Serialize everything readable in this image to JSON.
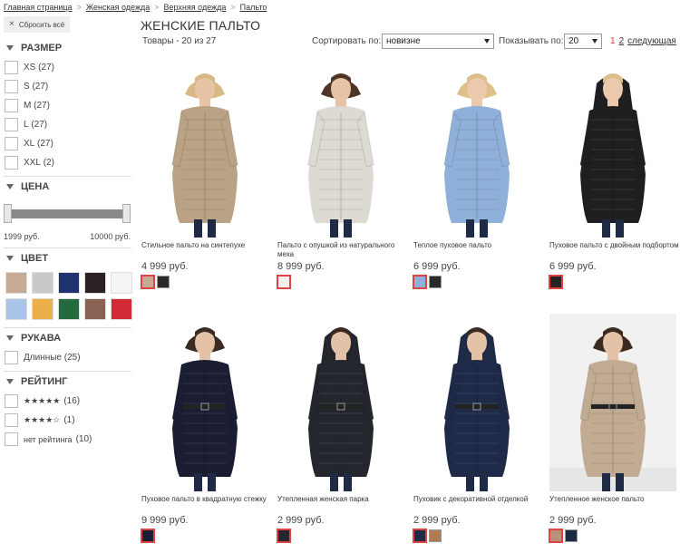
{
  "breadcrumb": [
    "Главная страница",
    "Женская одежда",
    "Верхняя одежда",
    "Пальто"
  ],
  "breadcrumb_sep": ">",
  "sidebar": {
    "reset_label": "Сбросить всё",
    "size": {
      "title": "РАЗМЕР",
      "options": [
        {
          "label": "XS",
          "count": "(27)"
        },
        {
          "label": "S",
          "count": "(27)"
        },
        {
          "label": "M",
          "count": "(27)"
        },
        {
          "label": "L",
          "count": "(27)"
        },
        {
          "label": "XL",
          "count": "(27)"
        },
        {
          "label": "XXL",
          "count": "(2)"
        }
      ]
    },
    "price": {
      "title": "ЦЕНА",
      "min": "1999 руб.",
      "max": "10000 руб."
    },
    "color": {
      "title": "ЦВЕТ",
      "swatches": [
        "#c8a994",
        "#c9c9c9",
        "#1f3270",
        "#2a2222",
        "#f4f4f4",
        "#a9c4e8",
        "#ecb04a",
        "#236b3f",
        "#8a6253",
        "#d32a35"
      ]
    },
    "sleeve": {
      "title": "РУКАВА",
      "options": [
        {
          "label": "Длинные",
          "count": "(25)"
        }
      ]
    },
    "rating": {
      "title": "РЕЙТИНГ",
      "options": [
        {
          "stars": "★★★★★",
          "count": "(16)"
        },
        {
          "stars": "★★★★☆",
          "count": "(1)"
        },
        {
          "stars": "нет рейтинга",
          "count": "(10)"
        }
      ]
    }
  },
  "main": {
    "title": "ЖЕНСКИЕ ПАЛЬТО",
    "count": "Товары - 20 из 27",
    "sort_label": "Сортировать по:",
    "sort_value": "новизне",
    "show_label": "Показывать по:",
    "show_value": "20",
    "pager": {
      "current": "1",
      "page2": "2",
      "next": "следующая"
    }
  },
  "products": [
    {
      "name": "Стильное пальто на синтепухе",
      "price": "4 999 руб.",
      "coat": "#b9a384",
      "skin": "#e8c4a6",
      "hair": "#d7b985",
      "swatches": [
        "#c8a994",
        "#2a2a2a"
      ],
      "selected": 0
    },
    {
      "name": "Пальто с опушкой из натурального меха",
      "price": "8 999 руб.",
      "coat": "#dcdad2",
      "skin": "#e6c2a6",
      "hair": "#4e3525",
      "swatches": [
        "#f2f0ea"
      ],
      "selected": 0
    },
    {
      "name": "Теплое пуховое пальто",
      "price": "6 999 руб.",
      "coat": "#8fb0d9",
      "skin": "#ecc9ad",
      "hair": "#dcc088",
      "swatches": [
        "#8fb0d9",
        "#2a2a2a"
      ],
      "selected": 0
    },
    {
      "name": "Пуховое пальто с двойным подбортом",
      "price": "6 999 руб.",
      "coat": "#1f1f22",
      "skin": "#ecc9ad",
      "hair": "#dcc088",
      "swatches": [
        "#2a2222"
      ],
      "selected": 0
    },
    {
      "name": "Пуховое пальто в квадратную стежку",
      "price": "9 999 руб.",
      "coat": "#1b1d33",
      "skin": "#e4c2a8",
      "hair": "#3a2a20",
      "swatches": [
        "#1b1d33"
      ],
      "selected": 0
    },
    {
      "name": "Утепленная женская парка",
      "price": "2 999 руб.",
      "coat": "#24262e",
      "skin": "#e4c2a8",
      "hair": "#3a2a20",
      "swatches": [
        "#24262e"
      ],
      "selected": 0
    },
    {
      "name": "Пуховик с декоративной отделкой",
      "price": "2 999 руб.",
      "coat": "#1e2a48",
      "skin": "#e4c2a8",
      "hair": "#3a2a20",
      "swatches": [
        "#1e2a48",
        "#b07b52"
      ],
      "selected": 0
    },
    {
      "name": "Утепленное женское пальто",
      "price": "2 999 руб.",
      "coat": "#c2ab93",
      "skin": "#e4c2a8",
      "hair": "#3a2a20",
      "swatches": [
        "#b9907a",
        "#1c2a40"
      ],
      "selected": 0
    }
  ]
}
